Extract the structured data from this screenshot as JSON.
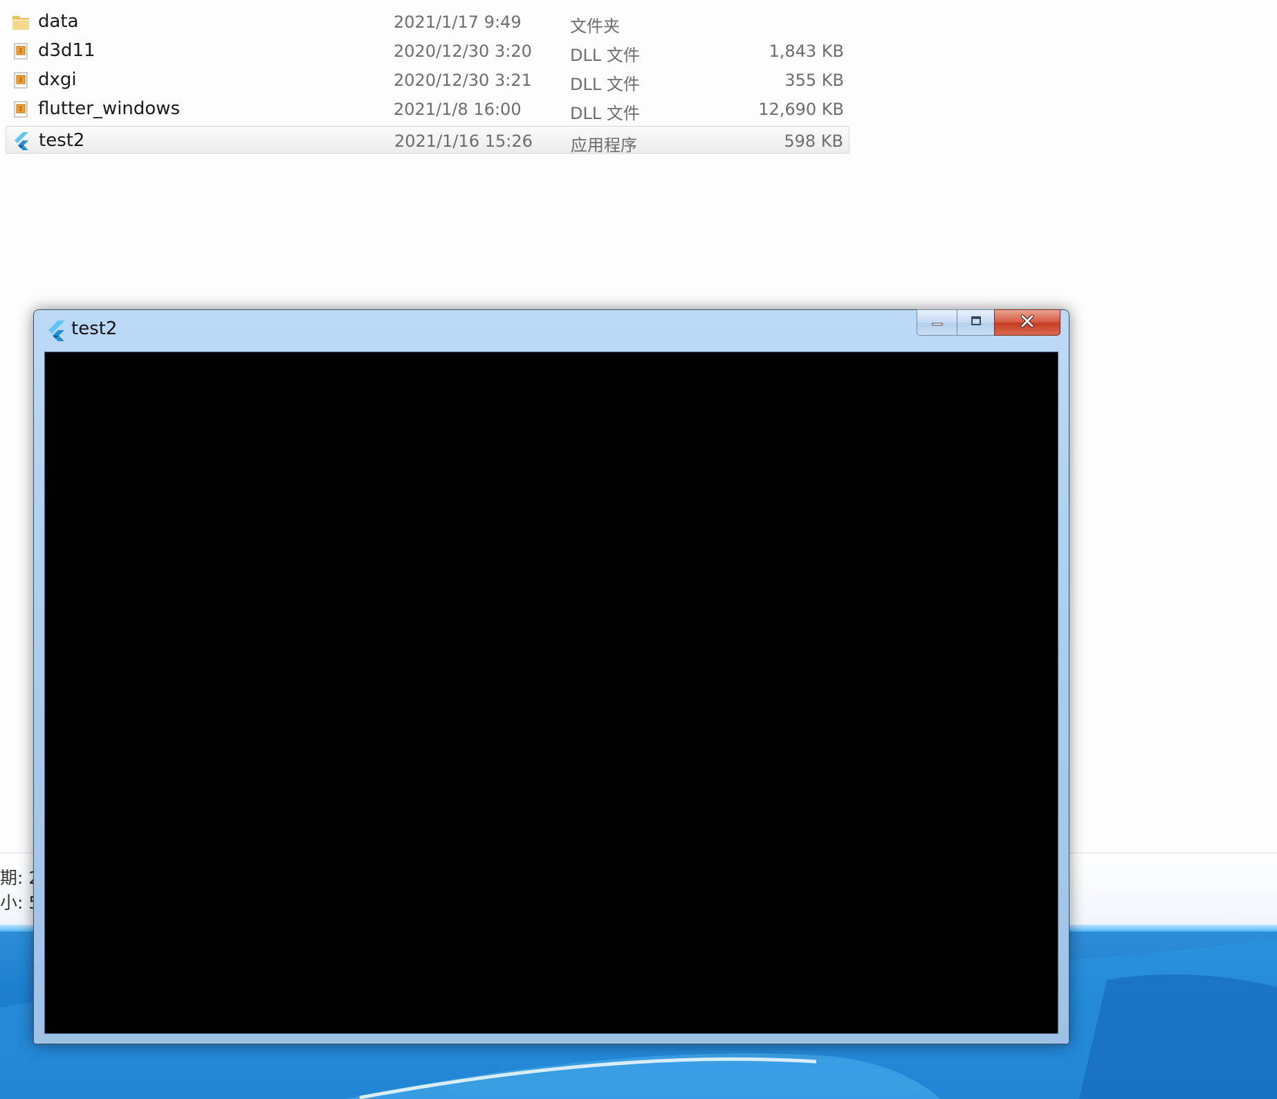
{
  "explorer": {
    "files": [
      {
        "name": "data",
        "date": "2021/1/17 9:49",
        "type": "文件夹",
        "size": "",
        "icon": "folder-icon"
      },
      {
        "name": "d3d11",
        "date": "2020/12/30 3:20",
        "type": "DLL 文件",
        "size": "1,843 KB",
        "icon": "dll-file-icon"
      },
      {
        "name": "dxgi",
        "date": "2020/12/30 3:21",
        "type": "DLL 文件",
        "size": "355 KB",
        "icon": "dll-file-icon"
      },
      {
        "name": "flutter_windows",
        "date": "2021/1/8 16:00",
        "type": "DLL 文件",
        "size": "12,690 KB",
        "icon": "dll-file-icon"
      },
      {
        "name": "test2",
        "date": "2021/1/16 15:26",
        "type": "应用程序",
        "size": "598 KB",
        "icon": "flutter-app-icon",
        "selected": true
      }
    ],
    "details_pane": {
      "line1": "期: 2",
      "line2": "小: 5"
    }
  },
  "window": {
    "title": "test2",
    "icon": "flutter-logo-icon",
    "buttons": [
      "minimize-icon",
      "maximize-icon",
      "close-icon"
    ],
    "client_background": "#000000"
  },
  "colors": {
    "title_bar": "#bcdaf6",
    "close_button": "#c9452c",
    "selection": "#ececec",
    "desktop": "#1f7fd0"
  }
}
